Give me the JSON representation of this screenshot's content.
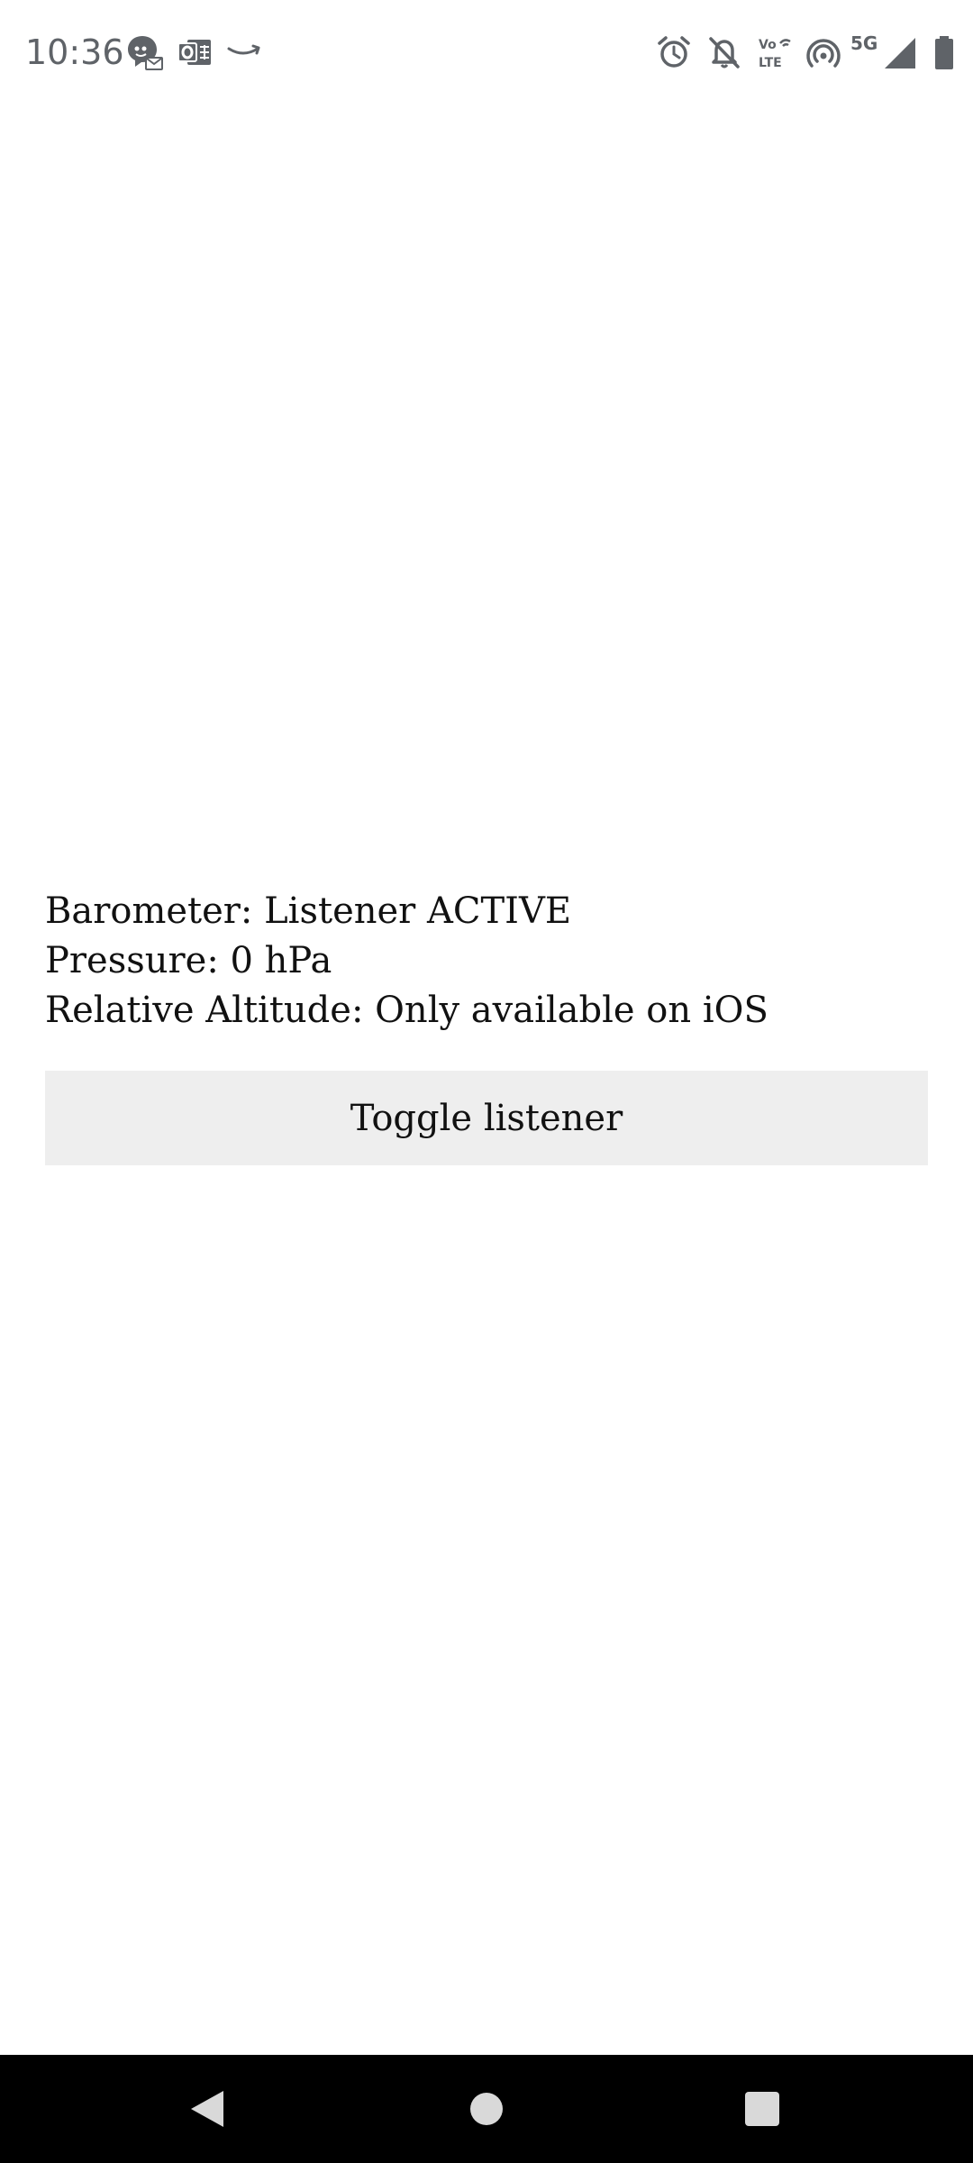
{
  "status_bar": {
    "time": "10:36",
    "left_icons": [
      "chat-notification-icon",
      "outlook-icon",
      "amazon-icon"
    ],
    "right_icons": [
      "alarm-icon",
      "notifications-off-icon",
      "volte-icon",
      "hotspot-icon",
      "signal-icon",
      "battery-icon"
    ],
    "network": "5G",
    "volte_label_top": "Vo",
    "volte_label_bottom": "LTE",
    "icon_color": "#5f6368"
  },
  "main": {
    "barometer_line": "Barometer: Listener ACTIVE",
    "pressure_line": "Pressure: 0 hPa",
    "altitude_line": "Relative Altitude: Only available on iOS",
    "toggle_button_label": "Toggle listener",
    "button_background": "#eeeeee"
  },
  "nav_bar": {
    "buttons": [
      "back-icon",
      "home-icon",
      "recents-icon"
    ],
    "background": "#000000"
  }
}
